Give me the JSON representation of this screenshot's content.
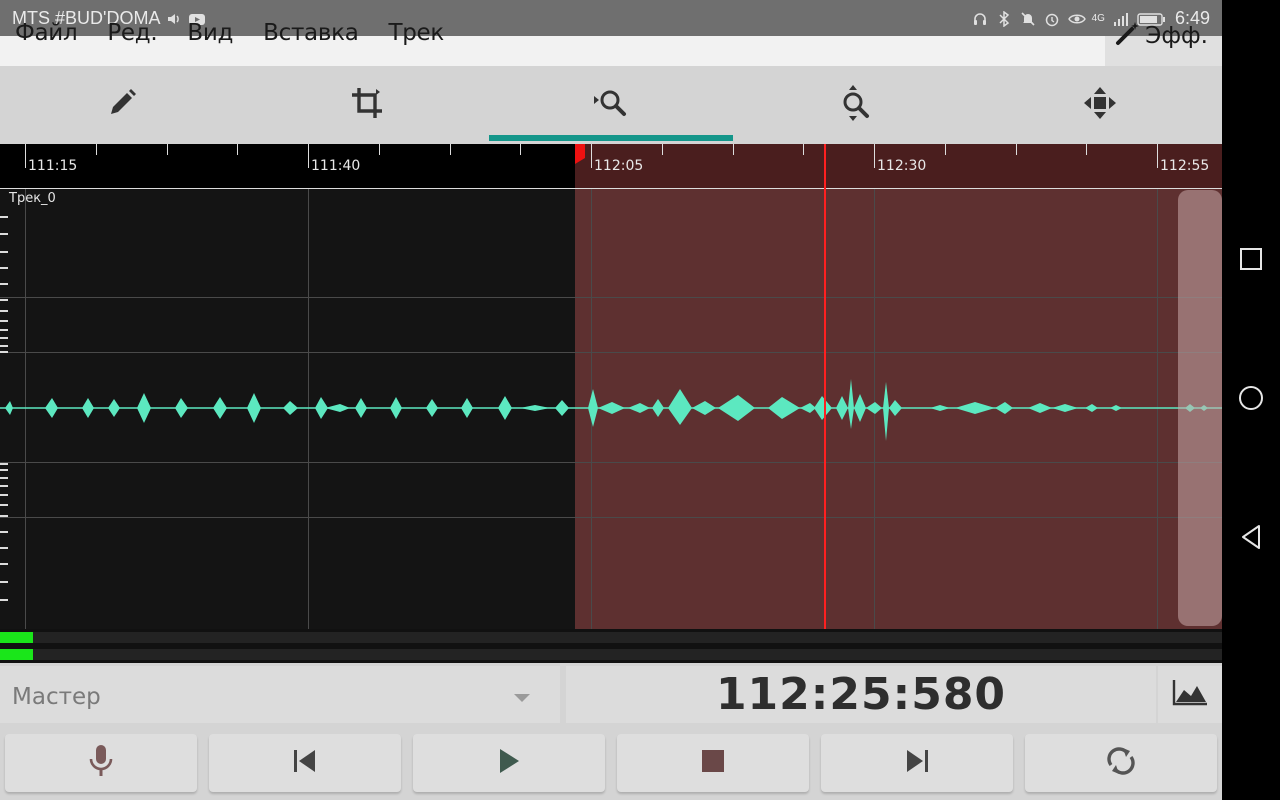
{
  "status_bar": {
    "carrier": "MTS #BUD'DOMA",
    "time": "6:49",
    "icons": [
      "volume-icon",
      "youtube-icon",
      "headset-icon",
      "bluetooth-icon",
      "mute-icon",
      "alarm-icon",
      "eye-icon",
      "signal-icon",
      "battery-icon"
    ],
    "network": "4G"
  },
  "menu": {
    "items": [
      "Файл",
      "Ред.",
      "Вид",
      "Вставка",
      "Трек"
    ],
    "effects_label": "Эфф."
  },
  "toolbar": {
    "tools": [
      "pencil-icon",
      "crop-icon",
      "zoom-horizontal-icon",
      "zoom-vertical-icon",
      "move-icon"
    ],
    "active_tool": "zoom-horizontal-icon"
  },
  "timeline": {
    "labels": [
      "111:15",
      "111:40",
      "112:05",
      "112:30",
      "112:55"
    ]
  },
  "track": {
    "name": "Трек_0"
  },
  "bottom": {
    "master_label": "Мастер",
    "current_time": "112:25:580"
  },
  "transport": {
    "buttons": [
      "microphone-icon",
      "skip-back-icon",
      "play-icon",
      "stop-icon",
      "skip-forward-icon",
      "loop-icon"
    ]
  },
  "colors": {
    "accent": "#14968a",
    "waveform": "#5ce8c0",
    "selection": "#5e3030",
    "playhead": "#ff2020",
    "meter": "#1ae61a"
  }
}
